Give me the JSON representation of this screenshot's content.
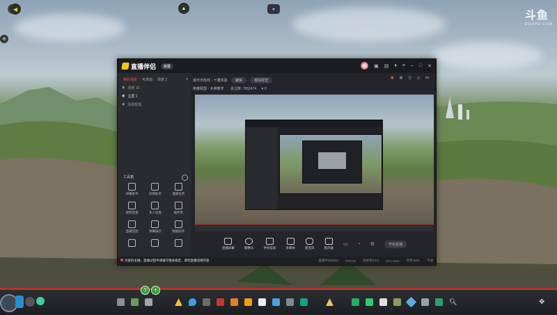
{
  "watermark": {
    "brand": "斗鱼",
    "url": "DOUYU.COM"
  },
  "app": {
    "name": "直播伴侣",
    "badge": "标签",
    "sidebar_tabs": [
      "我的场景",
      "可添加",
      "场景 2"
    ],
    "scenes": [
      "场景 10",
      "主屏 1",
      "场景配置"
    ],
    "tools_title": "工具箱",
    "tools": [
      "弹幕助手",
      "房管助手",
      "直播任务",
      "视频连麦",
      "多人连麦",
      "抽奖券",
      "直播回放",
      "弹幕展示",
      "数据助手",
      "",
      "",
      ""
    ],
    "room_title": "城市天际线 - 十堰体验",
    "edit_label": "编辑",
    "category": "模拟经营",
    "room_type": "英雄联盟 - 大神教学",
    "follow_text": "关注数:",
    "follow_count": "7652474",
    "gift_count": "0",
    "bottom_buttons": [
      "直播屏幕",
      "摄像头",
      "手机投屏",
      "多媒体",
      "麦克风",
      "扬声器"
    ],
    "start_button": "开始直播",
    "status_warning": "亲爱的主播，直播过程中请遵守相关规定，请勿直播违规内容",
    "status_items": [
      "直播中(0KB/s)",
      "FPS:20",
      "丢帧率(0%)",
      "CPU:23%",
      "内存:62%",
      "平滑"
    ]
  },
  "colors": {
    "accent": "#f0564a",
    "window": "#24252a",
    "sidebar": "#2a2b30",
    "gamebar_stripe": "#b3362c"
  }
}
